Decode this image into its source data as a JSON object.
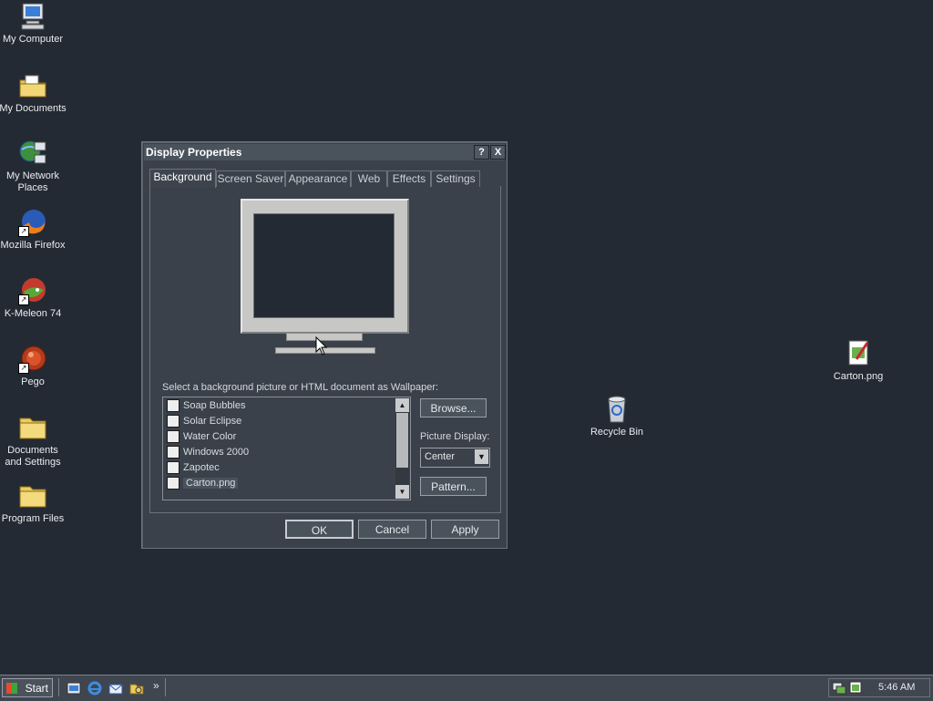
{
  "desktop": {
    "icons": [
      {
        "label": "My Computer",
        "icon": "my-computer-icon"
      },
      {
        "label": "My Documents",
        "icon": "my-documents-icon"
      },
      {
        "label": "My Network Places",
        "icon": "network-places-icon"
      },
      {
        "label": "Mozilla Firefox",
        "icon": "firefox-icon"
      },
      {
        "label": "K-Meleon 74",
        "icon": "k-meleon-icon"
      },
      {
        "label": "Pego",
        "icon": "pego-icon"
      },
      {
        "label": "Documents and Settings",
        "icon": "folder-icon"
      },
      {
        "label": "Program Files",
        "icon": "folder-icon"
      },
      {
        "label": "Recycle Bin",
        "icon": "recycle-bin-icon"
      },
      {
        "label": "Carton.png",
        "icon": "image-file-icon"
      }
    ]
  },
  "dialog": {
    "title": "Display Properties",
    "help_button": "?",
    "close_button": "X",
    "tabs": [
      "Background",
      "Screen Saver",
      "Appearance",
      "Web",
      "Effects",
      "Settings"
    ],
    "active_tab": "Background",
    "instruction": "Select a background picture or HTML document as Wallpaper:",
    "wallpapers": [
      "Soap Bubbles",
      "Solar Eclipse",
      "Water Color",
      "Windows 2000",
      "Zapotec",
      "Carton.png"
    ],
    "selected_wallpaper": "Carton.png",
    "browse_label": "Browse...",
    "picture_display_label": "Picture Display:",
    "picture_display_value": "Center",
    "pattern_label": "Pattern...",
    "ok_label": "OK",
    "cancel_label": "Cancel",
    "apply_label": "Apply"
  },
  "taskbar": {
    "start_label": "Start",
    "quick_launch": [
      "show-desktop-icon",
      "internet-explorer-icon",
      "outlook-express-icon",
      "windows-explorer-icon"
    ],
    "overflow": "»",
    "clock": "5:46 AM"
  },
  "colors": {
    "desktop_bg": "#242a33",
    "dialog_bg": "#3a414a",
    "taskbar_bg": "#3f4650"
  }
}
